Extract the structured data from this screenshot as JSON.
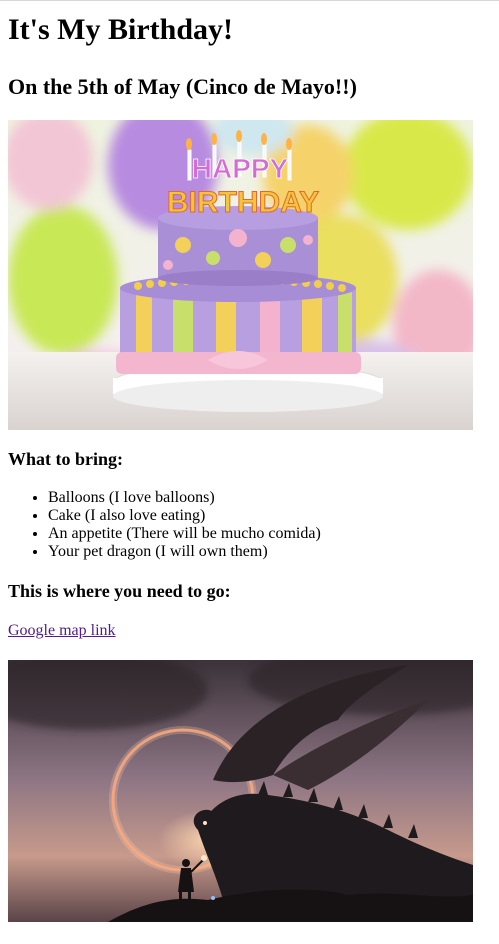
{
  "header": {
    "title": "It's My Birthday!",
    "subtitle": "On the 5th of May (Cinco de Mayo!!)"
  },
  "cake_image": {
    "icon": "birthday-cake-image",
    "topper_text_1": "HAPPY",
    "topper_text_2": "BIRTHDAY"
  },
  "bring": {
    "heading": "What to bring:",
    "items": [
      "Balloons (I love balloons)",
      "Cake (I also love eating)",
      "An appetite (There will be mucho comida)",
      "Your pet dragon (I will own them)"
    ]
  },
  "directions": {
    "heading": "This is where you need to go:",
    "link_label": "Google map link"
  },
  "dragon_image": {
    "icon": "dragon-illustration-image"
  },
  "colors": {
    "link_visited": "#551a8b",
    "cake_purple": "#a98fd6",
    "cake_pink": "#f4b6cf"
  }
}
